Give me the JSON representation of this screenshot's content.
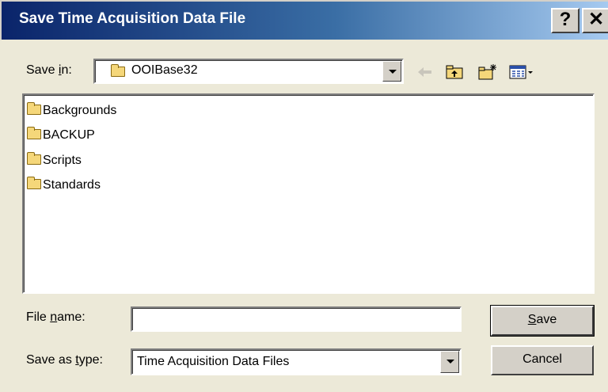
{
  "window": {
    "title": "Save Time Acquisition Data File",
    "help_label": "?",
    "close_label": "✕"
  },
  "save_in": {
    "label_prefix": "Save ",
    "label_access": "i",
    "label_suffix": "n:",
    "value": "OOIBase32"
  },
  "toolbar": {
    "back_icon": "back-arrow-icon",
    "up_icon": "up-one-level-icon",
    "new_folder_icon": "new-folder-icon",
    "view_icon": "view-menu-icon"
  },
  "files": [
    "Backgrounds",
    "BACKUP",
    "Scripts",
    "Standards"
  ],
  "file_name": {
    "label_prefix": "File ",
    "label_access": "n",
    "label_suffix": "ame:",
    "value": ""
  },
  "save_as_type": {
    "label_prefix": "Save as ",
    "label_access": "t",
    "label_suffix": "ype:",
    "value": "Time Acquisition Data Files"
  },
  "buttons": {
    "save_access": "S",
    "save_rest": "ave",
    "cancel": "Cancel"
  }
}
